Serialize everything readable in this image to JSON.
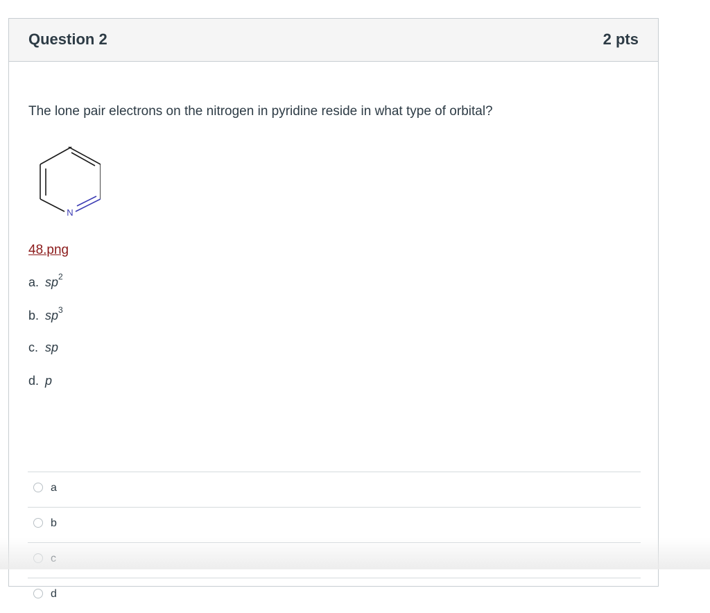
{
  "question": {
    "title": "Question 2",
    "points": "2 pts",
    "text": "The lone pair electrons on the nitrogen in pyridine reside in what type of orbital?",
    "image_atom_label": "N",
    "attachment_link": "48.png"
  },
  "options": [
    {
      "letter": "a.",
      "base": "sp",
      "sup": "2"
    },
    {
      "letter": "b.",
      "base": "sp",
      "sup": "3"
    },
    {
      "letter": "c.",
      "base": "sp",
      "sup": ""
    },
    {
      "letter": "d.",
      "base": "p",
      "sup": ""
    }
  ],
  "answers": [
    {
      "label": "a",
      "selected": false
    },
    {
      "label": "b",
      "selected": false
    },
    {
      "label": "c",
      "selected": false
    },
    {
      "label": "d",
      "selected": false
    }
  ],
  "colors": {
    "link": "#8b1a1a",
    "nitrogen": "#3b3bb3",
    "header_bg": "#f5f5f5",
    "border": "#c7cdd1"
  }
}
